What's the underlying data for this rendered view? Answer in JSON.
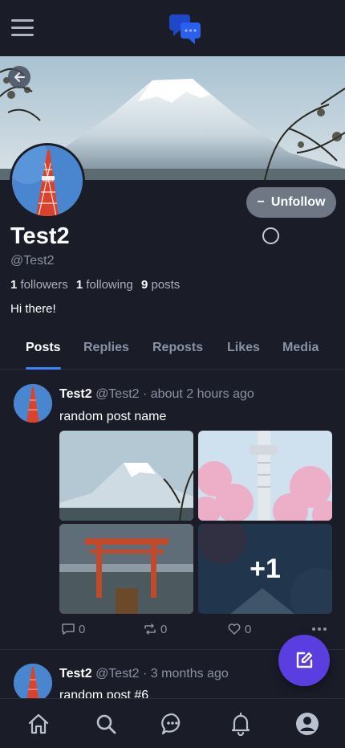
{
  "profile": {
    "display_name": "Test2",
    "handle": "@Test2",
    "followers_count": "1",
    "followers_label": "followers",
    "following_count": "1",
    "following_label": "following",
    "posts_count": "9",
    "posts_label": "posts",
    "bio": "Hi there!",
    "unfollow_label": "Unfollow"
  },
  "tabs": [
    {
      "label": "Posts",
      "active": true
    },
    {
      "label": "Replies",
      "active": false
    },
    {
      "label": "Reposts",
      "active": false
    },
    {
      "label": "Likes",
      "active": false
    },
    {
      "label": "Media",
      "active": false
    }
  ],
  "posts": [
    {
      "author": "Test2",
      "handle": "@Test2",
      "separator": "·",
      "time": "about 2 hours ago",
      "text": "random post name",
      "extra_images_label": "+1",
      "comments": "0",
      "reposts": "0",
      "likes": "0"
    },
    {
      "author": "Test2",
      "handle": "@Test2",
      "separator": "·",
      "time": "3 months ago",
      "text": "random post #6"
    }
  ],
  "icons": {
    "menu": "hamburger-icon",
    "logo": "chat-bubbles-logo",
    "back": "arrow-left-icon",
    "comment": "comment-icon",
    "repost": "repost-icon",
    "like": "heart-icon",
    "more": "more-dots-icon",
    "compose": "compose-icon",
    "home": "home-icon",
    "search": "search-icon",
    "messages": "messages-icon",
    "notifications": "bell-icon",
    "account": "user-icon"
  },
  "colors": {
    "background": "#1a1d27",
    "accent_blue": "#3a84ff",
    "fab_purple": "#5a3ee0",
    "button_gray": "#6f7785"
  }
}
